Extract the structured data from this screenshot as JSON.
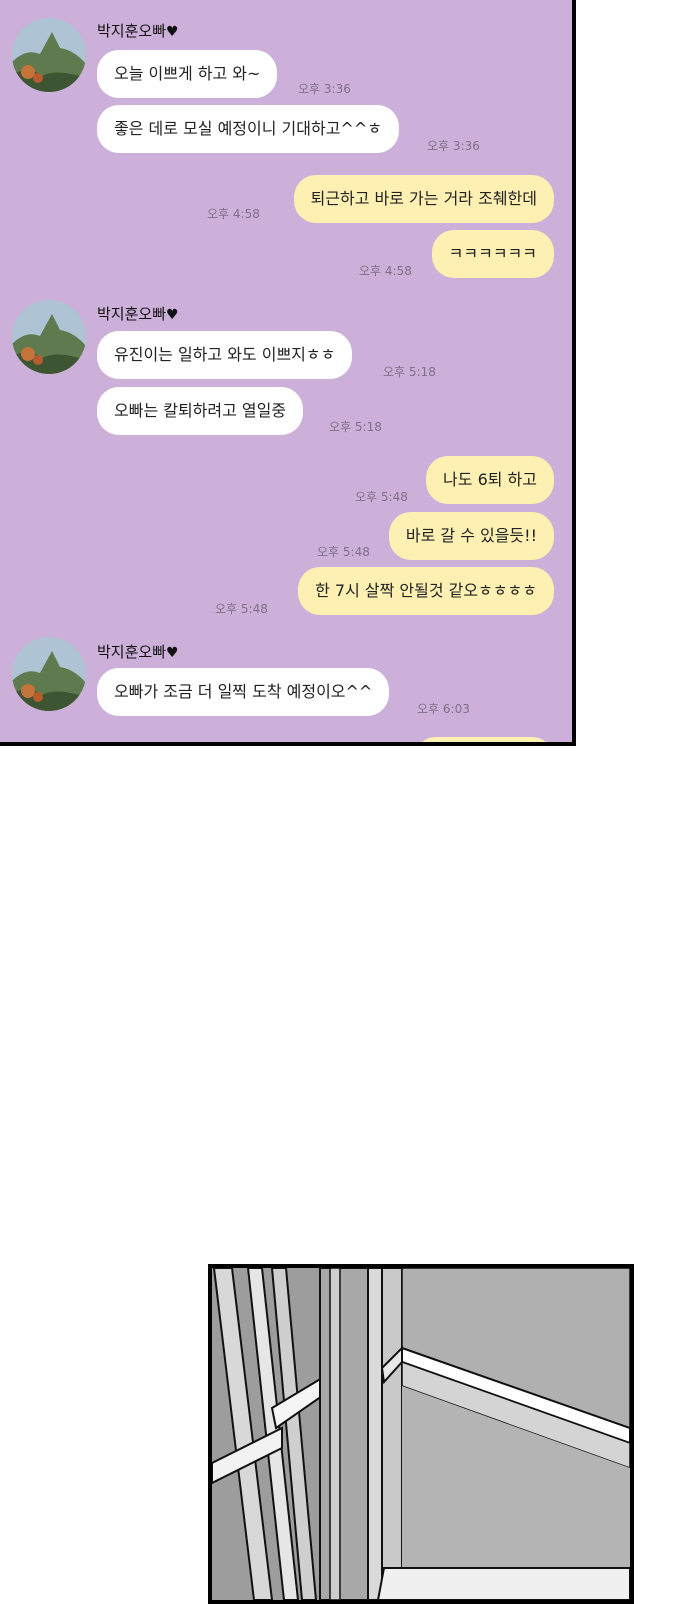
{
  "chat": {
    "sender_name": "박지훈오빠",
    "heart_glyph": "♥",
    "messages": [
      {
        "text": "오늘 이쁘게 하고 와~",
        "time": "오후 3:36"
      },
      {
        "text": "좋은 데로 모실 예정이니 기대하고^^ㅎ",
        "time": "오후 3:36"
      },
      {
        "text": "퇴근하고 바로 가는 거라 조췌한데",
        "time": "오후 4:58"
      },
      {
        "text": "ㅋㅋㅋㅋㅋㅋ",
        "time": "오후 4:58"
      },
      {
        "text": "유진이는 일하고 와도 이쁘지ㅎㅎ",
        "time": "오후 5:18"
      },
      {
        "text": "오빠는 칼퇴하려고 열일중",
        "time": "오후 5:18"
      },
      {
        "text": "나도 6퇴 하고",
        "time": "오후 5:48"
      },
      {
        "text": "바로 갈 수 있을듯!!",
        "time": "오후 5:48"
      },
      {
        "text": "한 7시 살짝 안될것 같오ㅎㅎㅎㅎ",
        "time": "오후 5:48"
      },
      {
        "text": "오빠가 조금 더 일찍 도착 예정이오^^",
        "time": "오후 6:03"
      }
    ]
  },
  "colors": {
    "chat_background": "#cdb0da",
    "incoming_bubble": "#ffffff",
    "outgoing_bubble": "#fdf0b2"
  },
  "icons": [
    "avatar-photo",
    "heart-icon"
  ]
}
